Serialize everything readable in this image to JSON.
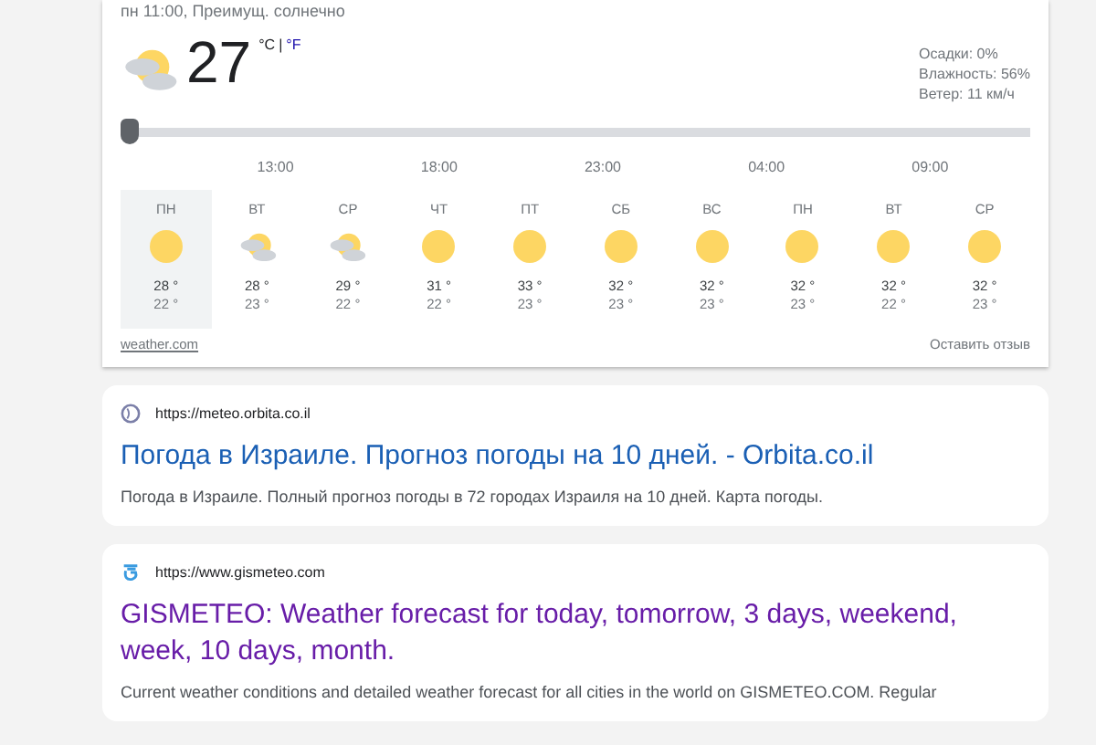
{
  "weather": {
    "subtitle": "пн 11:00, Преимущ. солнечно",
    "temperature": "27",
    "unit_c": "°C",
    "unit_sep": "|",
    "unit_f": "°F",
    "details": [
      "Осадки: 0%",
      "Влажность: 56%",
      "Ветер: 11 км/ч"
    ],
    "slider": {
      "level": 0
    },
    "times": [
      "13:00",
      "18:00",
      "23:00",
      "04:00",
      "09:00"
    ],
    "days": [
      {
        "day": "ПН",
        "kind": "sun",
        "high": "28 °",
        "low": "22 °",
        "selected": true
      },
      {
        "day": "ВТ",
        "kind": "partly-cloudy",
        "high": "28 °",
        "low": "23 °",
        "selected": false
      },
      {
        "day": "СР",
        "kind": "partly-cloudy",
        "high": "29 °",
        "low": "22 °",
        "selected": false
      },
      {
        "day": "ЧТ",
        "kind": "sun",
        "high": "31 °",
        "low": "22 °",
        "selected": false
      },
      {
        "day": "ПТ",
        "kind": "sun",
        "high": "33 °",
        "low": "23 °",
        "selected": false
      },
      {
        "day": "СБ",
        "kind": "sun",
        "high": "32 °",
        "low": "23 °",
        "selected": false
      },
      {
        "day": "ВС",
        "kind": "sun",
        "high": "32 °",
        "low": "23 °",
        "selected": false
      },
      {
        "day": "ПН",
        "kind": "sun",
        "high": "32 °",
        "low": "23 °",
        "selected": false
      },
      {
        "day": "ВТ",
        "kind": "sun",
        "high": "32 °",
        "low": "22 °",
        "selected": false
      },
      {
        "day": "СР",
        "kind": "sun",
        "high": "32 °",
        "low": "23 °",
        "selected": false
      }
    ],
    "source": "weather.com",
    "feedback": "Оставить отзыв"
  },
  "results": [
    {
      "kind": "globe",
      "url": "https://meteo.orbita.co.il",
      "title": "Погода в Израиле. Прогноз погоды на 10 дней. - Orbita.co.il",
      "visited": false,
      "snippet": "Погода в Израиле. Полный прогноз погоды в 72 городах Израиля на 10 дней. Карта погоды."
    },
    {
      "kind": "gismeteo",
      "url": "https://www.gismeteo.com",
      "title": "GISMETEO: Weather forecast for today, tomorrow, 3 days, weekend, week, 10 days, month.",
      "visited": true,
      "snippet": "Current weather conditions and detailed weather forecast for all cities in the world on GISMETEO.COM. Regular"
    }
  ]
}
